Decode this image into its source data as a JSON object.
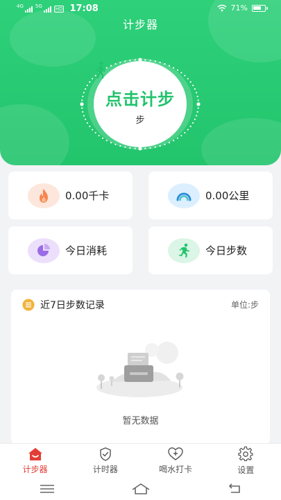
{
  "status_bar": {
    "network_small": "4G",
    "network_small2": "5G",
    "hd": "HD",
    "time": "17:08",
    "battery": "71%"
  },
  "header": {
    "title": "计步器"
  },
  "dial": {
    "main_label": "点击计步",
    "unit": "步"
  },
  "stats": [
    {
      "value": "0.00千卡",
      "icon": "flame-icon"
    },
    {
      "value": "0.00公里",
      "icon": "speedometer-icon"
    },
    {
      "value": "今日消耗",
      "icon": "pie-chart-icon"
    },
    {
      "value": "今日步数",
      "icon": "running-icon"
    }
  ],
  "record": {
    "title": "近7日步数记录",
    "unit": "单位:步",
    "empty": "暂无数据"
  },
  "tabs": [
    {
      "label": "计步器",
      "icon": "home-icon",
      "active": true
    },
    {
      "label": "计时器",
      "icon": "timer-shield-icon",
      "active": false
    },
    {
      "label": "喝水打卡",
      "icon": "heart-plus-icon",
      "active": false
    },
    {
      "label": "设置",
      "icon": "gear-icon",
      "active": false
    }
  ],
  "colors": {
    "brand_green": "#22c46c",
    "active_red": "#e23d35"
  }
}
